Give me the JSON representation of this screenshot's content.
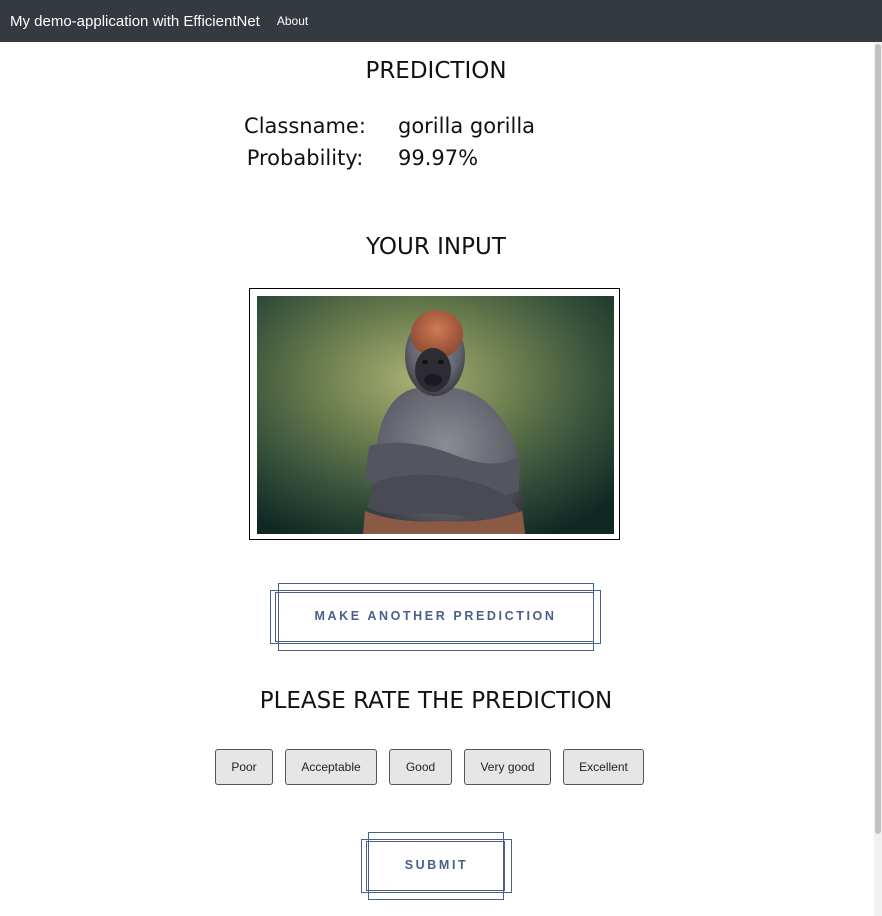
{
  "navbar": {
    "brand": "My demo-application with EfficientNet",
    "about": "About"
  },
  "prediction": {
    "heading": "PREDICTION",
    "classname_label": "Classname:",
    "classname_value": "gorilla gorilla",
    "probability_label": "Probability:",
    "probability_value": "99.97%"
  },
  "input": {
    "heading": "YOUR INPUT"
  },
  "make_another_label": "MAKE ANOTHER PREDICTION",
  "rating": {
    "heading": "PLEASE RATE THE PREDICTION",
    "options": [
      "Poor",
      "Acceptable",
      "Good",
      "Very good",
      "Excellent"
    ]
  },
  "submit_label": "SUBMIT",
  "colors": {
    "navbar": "#343a40",
    "accent": "#4a6088",
    "rate_button_bg": "#e6e6e6"
  }
}
